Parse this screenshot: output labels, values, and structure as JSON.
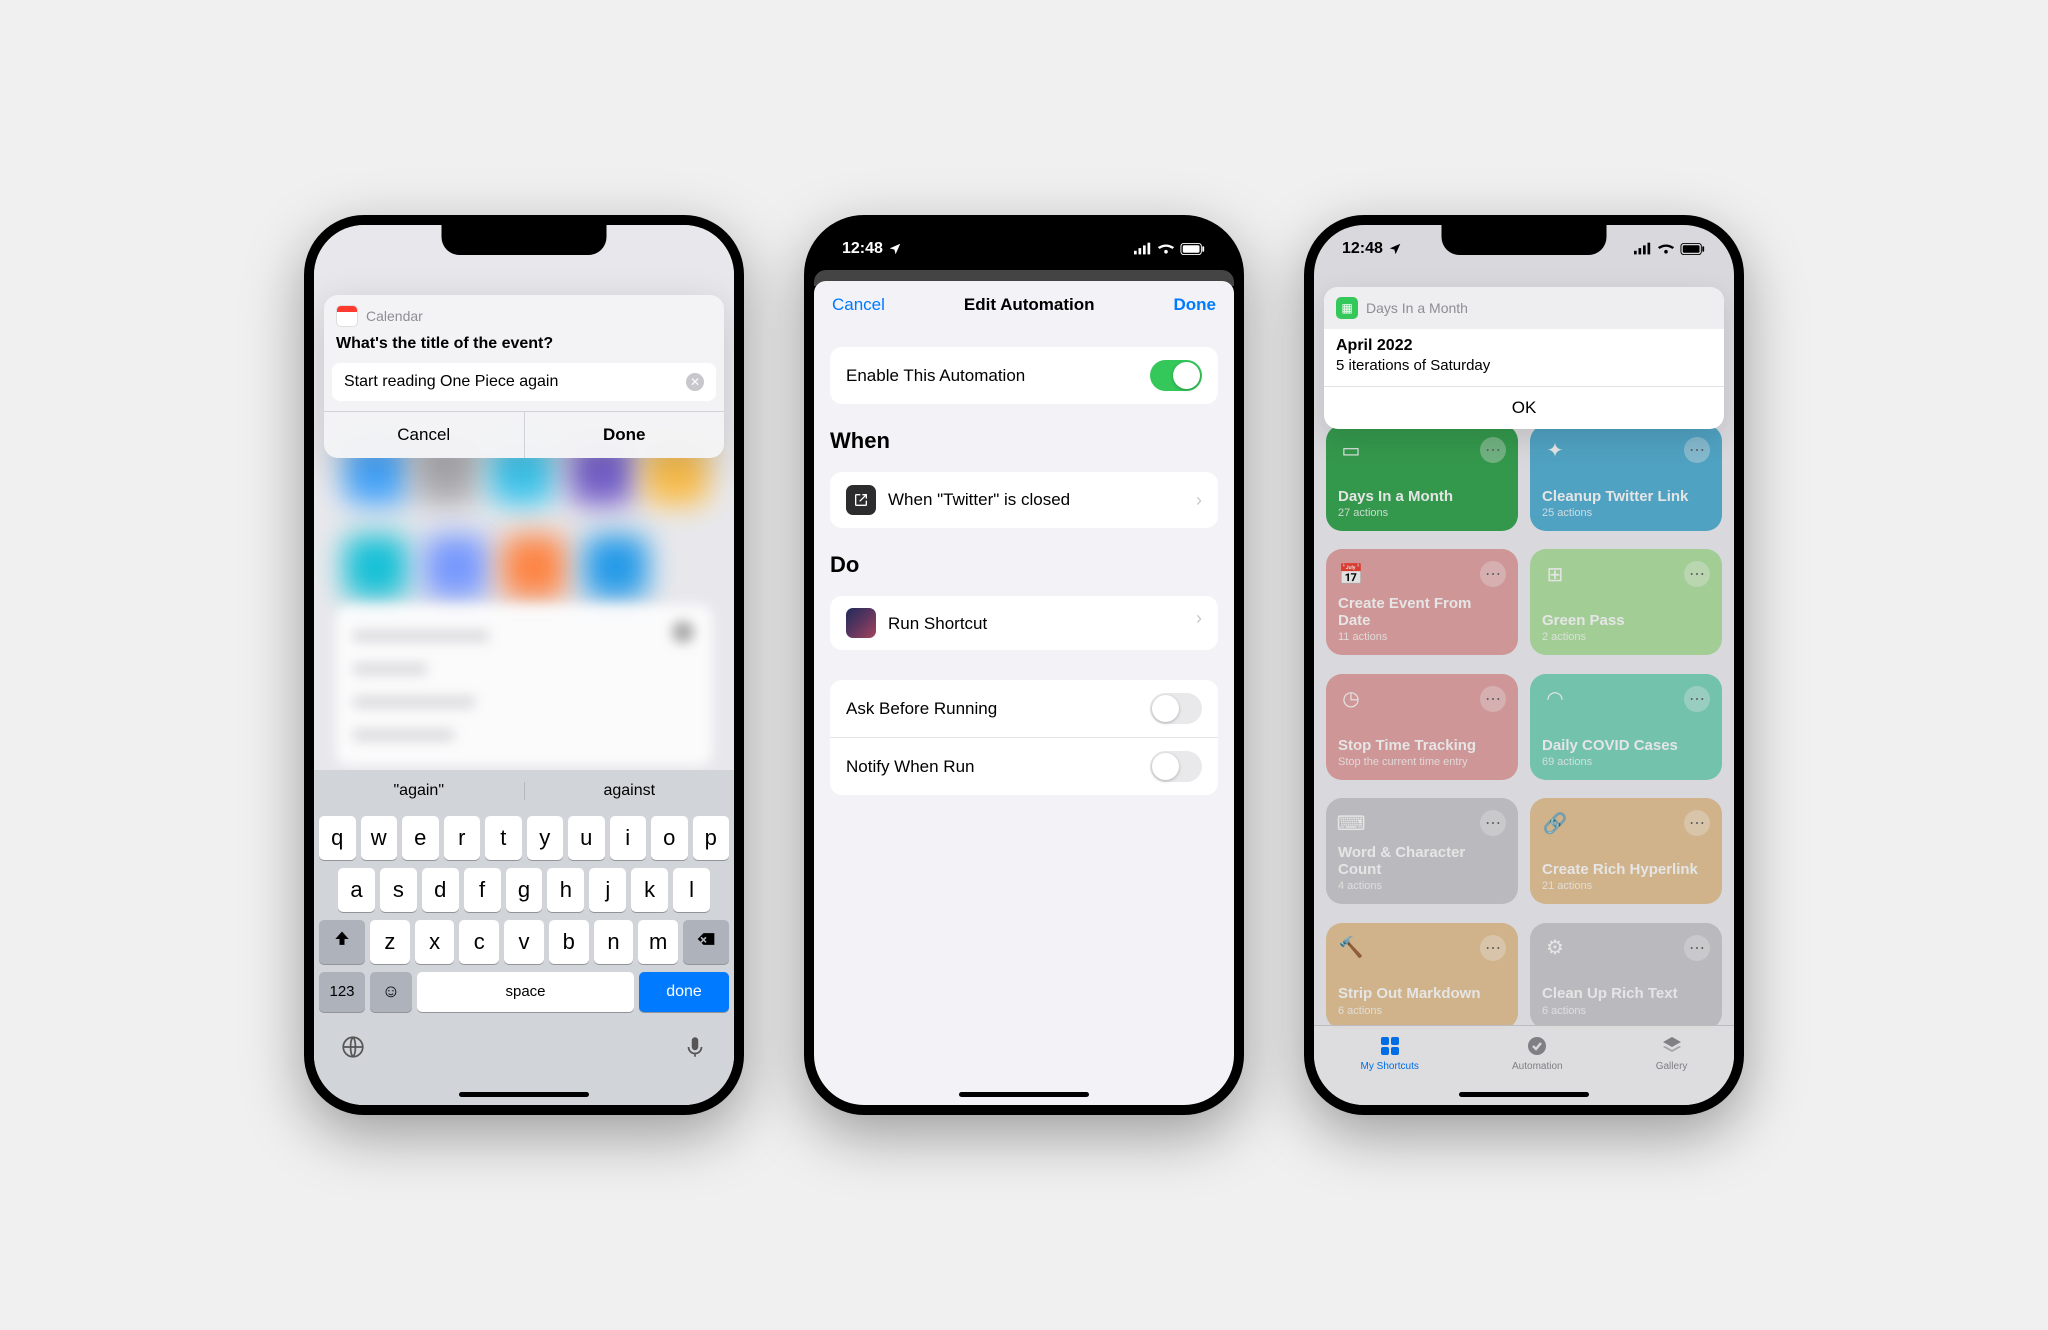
{
  "status": {
    "time": "12:48",
    "signal": true,
    "wifi": true,
    "battery": true
  },
  "phone1": {
    "app_name": "Calendar",
    "prompt": "What's the title of the event?",
    "input_value": "Start reading One Piece again",
    "btn_cancel": "Cancel",
    "btn_done": "Done",
    "suggestions": [
      "\"again\"",
      "against"
    ],
    "keyboard": {
      "row1": [
        "q",
        "w",
        "e",
        "r",
        "t",
        "y",
        "u",
        "i",
        "o",
        "p"
      ],
      "row2": [
        "a",
        "s",
        "d",
        "f",
        "g",
        "h",
        "j",
        "k",
        "l"
      ],
      "row3": [
        "z",
        "x",
        "c",
        "v",
        "b",
        "n",
        "m"
      ],
      "num_key": "123",
      "space_key": "space",
      "done_key": "done"
    }
  },
  "phone2": {
    "nav": {
      "cancel": "Cancel",
      "title": "Edit Automation",
      "done": "Done"
    },
    "enable_label": "Enable This Automation",
    "enable_on": true,
    "section_when": "When",
    "when_text": "When \"Twitter\" is closed",
    "section_do": "Do",
    "do_text": "Run Shortcut",
    "ask_before": {
      "label": "Ask Before Running",
      "on": false
    },
    "notify": {
      "label": "Notify When Run",
      "on": false
    }
  },
  "phone3": {
    "banner": {
      "app": "Days In a Month",
      "title": "April 2022",
      "subtitle": "5 iterations of Saturday",
      "ok": "OK"
    },
    "tiles": [
      {
        "name": "Days In a Month",
        "actions": "27 actions",
        "color": "#3aaa55",
        "icon": "doc"
      },
      {
        "name": "Cleanup Twitter Link",
        "actions": "25 actions",
        "color": "#5ab5d9",
        "icon": "wand"
      },
      {
        "name": "Create Event From Date",
        "actions": "11 actions",
        "color": "#e6a7a7",
        "icon": "calendar-plus"
      },
      {
        "name": "Green Pass",
        "actions": "2 actions",
        "color": "#b5e6a7",
        "icon": "qr"
      },
      {
        "name": "Stop Time Tracking",
        "actions": "Stop the current time entry",
        "color": "#e6a7a7",
        "icon": "timer"
      },
      {
        "name": "Daily COVID Cases",
        "actions": "69 actions",
        "color": "#7fd8c0",
        "icon": "mask"
      },
      {
        "name": "Word & Character Count",
        "actions": "4 actions",
        "color": "#d0d0d4",
        "icon": "keyboard"
      },
      {
        "name": "Create Rich Hyperlink",
        "actions": "21 actions",
        "color": "#e8c89a",
        "icon": "link"
      },
      {
        "name": "Strip Out Markdown",
        "actions": "6 actions",
        "color": "#e8c89a",
        "icon": "hammer"
      },
      {
        "name": "Clean Up Rich Text",
        "actions": "6 actions",
        "color": "#d0d0d4",
        "icon": "gear"
      }
    ],
    "tabs": {
      "shortcuts": "My Shortcuts",
      "automation": "Automation",
      "gallery": "Gallery"
    }
  }
}
